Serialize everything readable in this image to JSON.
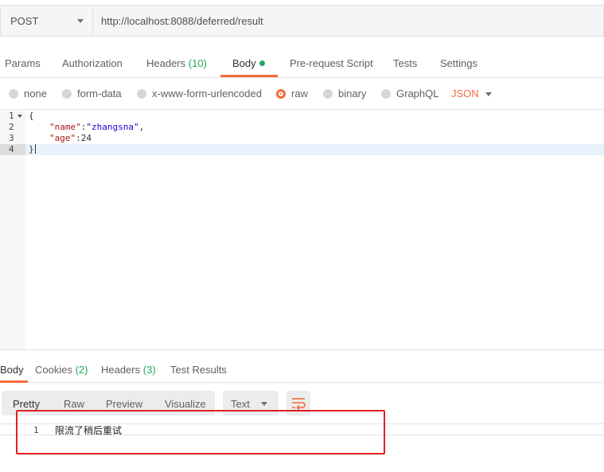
{
  "request": {
    "method": "POST",
    "url": "http://localhost:8088/deferred/result"
  },
  "request_tabs": [
    {
      "label": "Params"
    },
    {
      "label": "Authorization"
    },
    {
      "label": "Headers",
      "count": "(10)"
    },
    {
      "label": "Body",
      "active": true,
      "indicator": "green-dot-icon"
    },
    {
      "label": "Pre-request Script"
    },
    {
      "label": "Tests"
    },
    {
      "label": "Settings"
    }
  ],
  "body_types": [
    {
      "label": "none"
    },
    {
      "label": "form-data"
    },
    {
      "label": "x-www-form-urlencoded"
    },
    {
      "label": "raw",
      "selected": true
    },
    {
      "label": "binary"
    },
    {
      "label": "GraphQL"
    }
  ],
  "body_format": "JSON",
  "editor": {
    "lines": [
      {
        "number": "1",
        "text": "{"
      },
      {
        "number": "2",
        "key": "\"name\"",
        "sep": ":",
        "value": "\"zhangsna\"",
        "trail": ","
      },
      {
        "number": "3",
        "key": "\"age\"",
        "sep": ":",
        "value": "24",
        "trail": ""
      },
      {
        "number": "4",
        "text": "}"
      }
    ]
  },
  "response_tabs": [
    {
      "label": "Body",
      "active": true
    },
    {
      "label": "Cookies",
      "count": "(2)"
    },
    {
      "label": "Headers",
      "count": "(3)"
    },
    {
      "label": "Test Results"
    }
  ],
  "view_modes": [
    {
      "label": "Pretty",
      "active": true
    },
    {
      "label": "Raw"
    },
    {
      "label": "Preview"
    },
    {
      "label": "Visualize"
    }
  ],
  "response_format": "Text",
  "response_body": {
    "line_number": "1",
    "text": "限流了稍后重试"
  },
  "colors": {
    "accent": "#f26b3a",
    "count_green": "#26a65b",
    "highlight_red": "#e02020"
  }
}
